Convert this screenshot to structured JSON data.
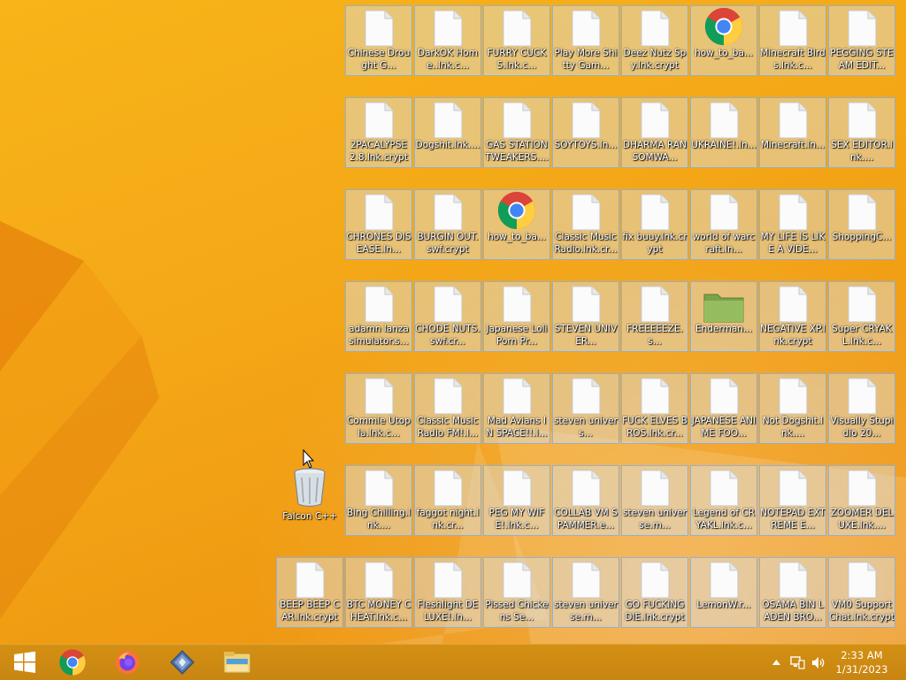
{
  "desktop": {
    "icons": [
      {
        "label": "Chinese Drought G...",
        "type": "file"
      },
      {
        "label": "DarkOK Home..lnk.c...",
        "type": "file"
      },
      {
        "label": "FURRY CUCKS.lnk.c...",
        "type": "file"
      },
      {
        "label": "Play More Shitty Gam...",
        "type": "file"
      },
      {
        "label": "Deez Nutz Spy.lnk.crypt",
        "type": "file"
      },
      {
        "label": "how_to_ba...",
        "type": "chrome"
      },
      {
        "label": "Minecraft Birds.lnk.c...",
        "type": "file"
      },
      {
        "label": "PEGGING STEAM EDIT...",
        "type": "file"
      },
      {
        "label": "2PACALYPSE 2.8.lnk.crypt",
        "type": "file"
      },
      {
        "label": "Dogshit.lnk....",
        "type": "file"
      },
      {
        "label": "GAS STATION TWEAKERS....",
        "type": "file"
      },
      {
        "label": "SOYTOYS.ln...",
        "type": "file"
      },
      {
        "label": "DHARMA RANSOMWA...",
        "type": "file"
      },
      {
        "label": "UKRAINE!.ln...",
        "type": "file"
      },
      {
        "label": "Minecraft.ln...",
        "type": "file"
      },
      {
        "label": "SEX EDITOR.lnk....",
        "type": "file"
      },
      {
        "label": "CHRONES DISEASE.ln...",
        "type": "file"
      },
      {
        "label": "BURGIN OUT.swf.crypt",
        "type": "file"
      },
      {
        "label": "how_to_ba...",
        "type": "chrome"
      },
      {
        "label": "Classic Music Radio.lnk.cr...",
        "type": "file"
      },
      {
        "label": "fix buuy.lnk.crypt",
        "type": "file"
      },
      {
        "label": "world of warcraft.ln...",
        "type": "file"
      },
      {
        "label": "MY LIFE IS LIKE A VIDE...",
        "type": "file"
      },
      {
        "label": "ShoppingC...",
        "type": "file"
      },
      {
        "label": "adamn lanza simulator.s...",
        "type": "file"
      },
      {
        "label": "CHODE NUTS.swf.cr...",
        "type": "file"
      },
      {
        "label": "Japanese Loli Porn Pr...",
        "type": "file"
      },
      {
        "label": "STEVEN UNIVER...",
        "type": "file"
      },
      {
        "label": "FREEEEEZE.s...",
        "type": "file"
      },
      {
        "label": "Enderman...",
        "type": "folder"
      },
      {
        "label": "NEGATIVE XP.lnk.crypt",
        "type": "file"
      },
      {
        "label": "Super CRYAKL.lnk.c...",
        "type": "file"
      },
      {
        "label": "Commie Utopia.lnk.c...",
        "type": "file"
      },
      {
        "label": "Classic Music Radio FM!.l...",
        "type": "file"
      },
      {
        "label": "Mad Avians IN SPACE!!.l...",
        "type": "file"
      },
      {
        "label": "steven univers...",
        "type": "file"
      },
      {
        "label": "FUCK ELVES BROS.lnk.cr...",
        "type": "file"
      },
      {
        "label": "JAPANESE ANIME FOO...",
        "type": "file"
      },
      {
        "label": "Not Dogshit.lnk....",
        "type": "file"
      },
      {
        "label": "Visually Stupidio 20...",
        "type": "file"
      },
      {
        "label": "Bing Chilling.lnk....",
        "type": "file"
      },
      {
        "label": "faggot night.lnk.cr...",
        "type": "file"
      },
      {
        "label": "PEG MY WIFE!.lnk.c...",
        "type": "file"
      },
      {
        "label": "COLLAB VM SPAMMER.e...",
        "type": "file"
      },
      {
        "label": "steven universe.m...",
        "type": "file"
      },
      {
        "label": "Legend of CRYAKL.lnk.c...",
        "type": "file"
      },
      {
        "label": "NOTEPAD EXTREME E...",
        "type": "file"
      },
      {
        "label": "ZOOMER DELUXE.lnk....",
        "type": "file"
      },
      {
        "label": "BEEP BEEP CAR.lnk.crypt",
        "type": "file"
      },
      {
        "label": "BTC MONEY CHEAT.lnk.c...",
        "type": "file"
      },
      {
        "label": "Fleshlight DELUXE!.ln...",
        "type": "file"
      },
      {
        "label": "Pissed Chickens Se...",
        "type": "file"
      },
      {
        "label": "steven universe.m...",
        "type": "file"
      },
      {
        "label": "GO FUCKING DIE.lnk.crypt",
        "type": "file"
      },
      {
        "label": "LemonW.r...",
        "type": "file"
      },
      {
        "label": "OSAMA BIN LADEN BRO...",
        "type": "file"
      },
      {
        "label": "VM0 Support Chat.lnk.crypt",
        "type": "file"
      }
    ],
    "recycle_bin": {
      "label": "Falcon C++"
    }
  },
  "taskbar": {
    "pinned": [
      {
        "name": "start-button",
        "icon": "windows-logo-icon"
      },
      {
        "name": "chrome-button",
        "icon": "chrome-icon"
      },
      {
        "name": "firefox-button",
        "icon": "firefox-icon"
      },
      {
        "name": "app-button",
        "icon": "diamond-app-icon"
      },
      {
        "name": "file-explorer-button",
        "icon": "file-explorer-icon"
      }
    ],
    "clock": {
      "time": "2:33 AM",
      "date": "1/31/2023"
    }
  },
  "colors": {
    "wallpaper": "#f4a817",
    "taskbar": "#cf8c12",
    "selection": "#84acdd"
  }
}
